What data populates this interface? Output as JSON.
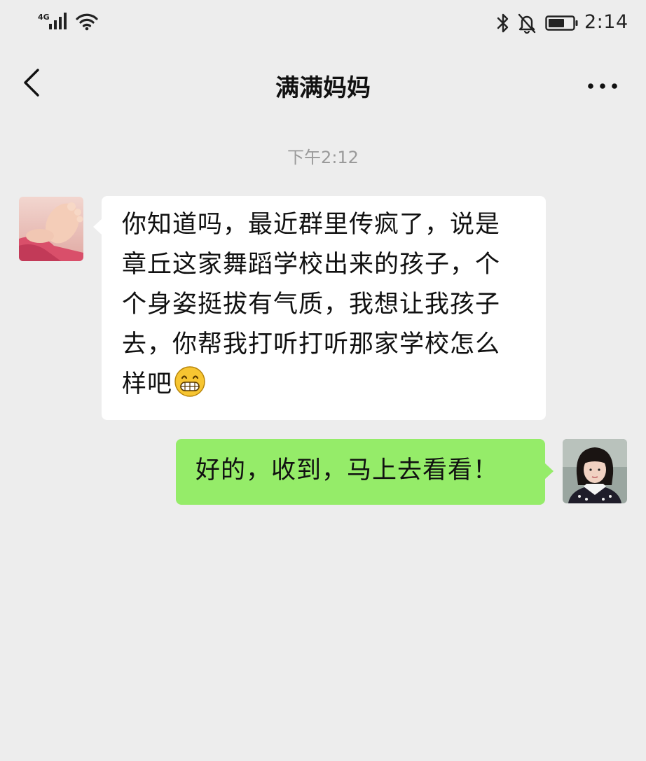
{
  "status_bar": {
    "network": "4G",
    "signal_icon": "signal-bars-icon",
    "wifi_icon": "wifi-icon",
    "bluetooth_icon": "bluetooth-icon",
    "mute_icon": "bell-off-icon",
    "battery_icon": "battery-icon",
    "time": "2:14"
  },
  "nav": {
    "back_icon": "chevron-left-icon",
    "title": "满满妈妈",
    "more_icon": "more-dots-icon"
  },
  "chat": {
    "timestamp": "下午2:12",
    "messages": [
      {
        "direction": "incoming",
        "lines": [
          "你知道吗，最近群里传疯了，说是",
          "章丘这家舞蹈学校出来的孩子，个",
          "个身姿挺拔有气质，我想让我孩子",
          "去，你帮我打听打听那家学校怎么",
          "样吧"
        ],
        "emoji": "grinning-face-emoji",
        "avatar": "contact-avatar"
      },
      {
        "direction": "outgoing",
        "text": "好的，收到，马上去看看！",
        "avatar": "my-avatar"
      }
    ]
  },
  "colors": {
    "background": "#ededed",
    "incoming_bubble": "#ffffff",
    "outgoing_bubble": "#95ec69",
    "timestamp": "#9a9a9a"
  }
}
